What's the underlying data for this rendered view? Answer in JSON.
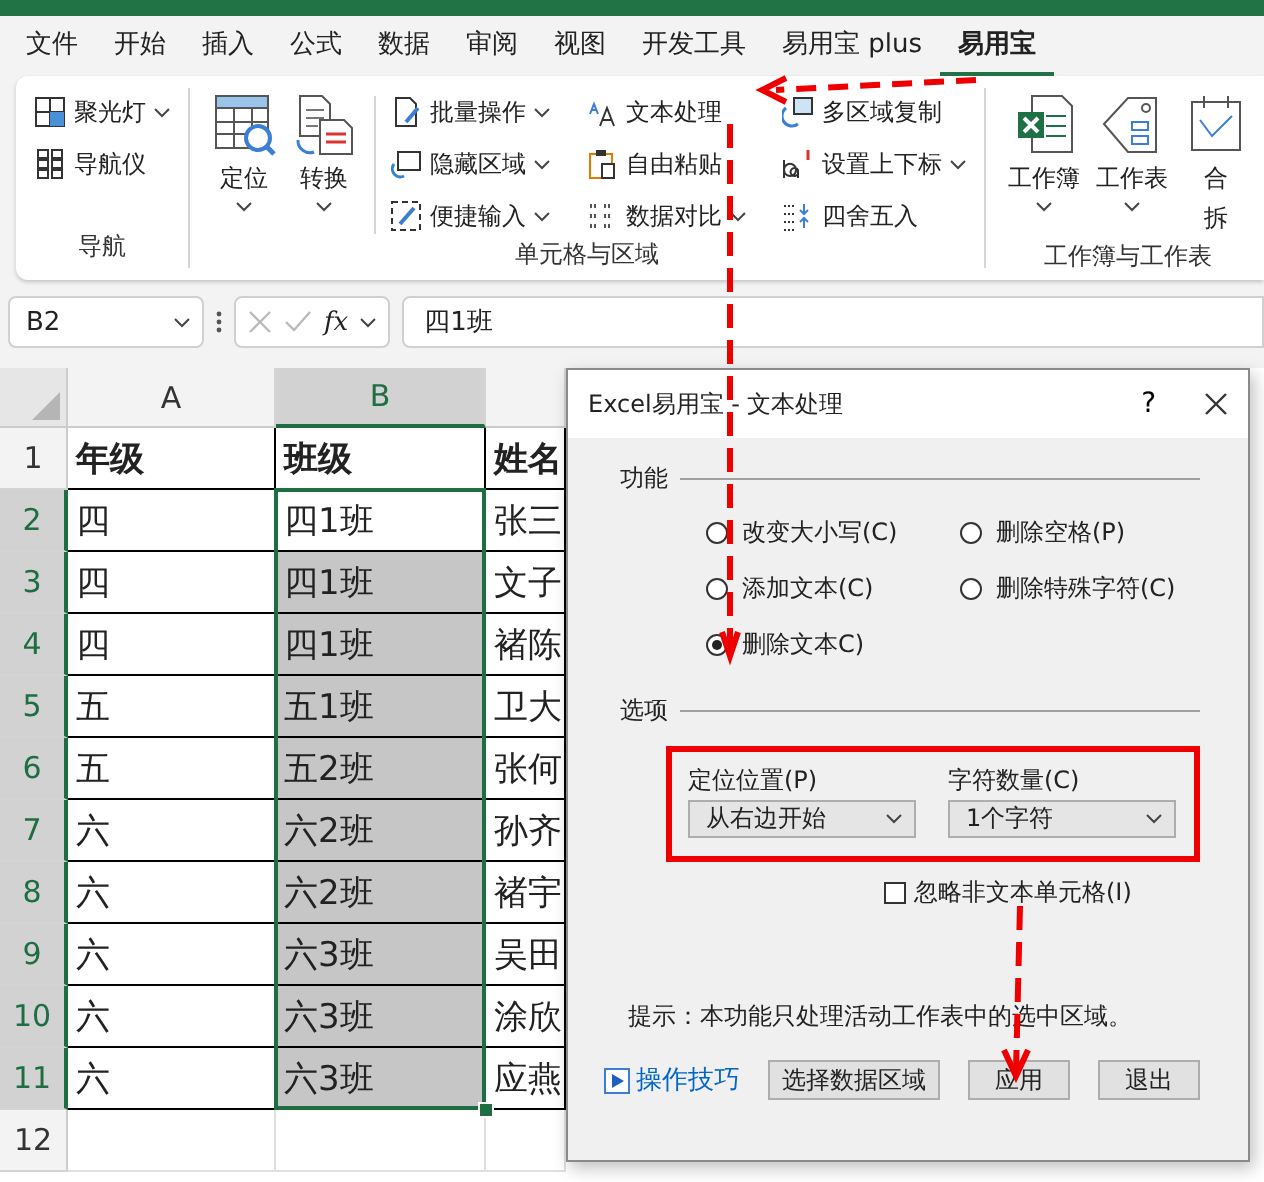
{
  "menu_tabs": [
    {
      "label": "文件",
      "selected": false
    },
    {
      "label": "开始",
      "selected": false
    },
    {
      "label": "插入",
      "selected": false
    },
    {
      "label": "公式",
      "selected": false
    },
    {
      "label": "数据",
      "selected": false
    },
    {
      "label": "审阅",
      "selected": false
    },
    {
      "label": "视图",
      "selected": false
    },
    {
      "label": "开发工具",
      "selected": false
    },
    {
      "label": "易用宝 plus",
      "selected": false
    },
    {
      "label": "易用宝",
      "selected": true
    }
  ],
  "ribbon": {
    "groups": [
      {
        "label": "导航",
        "small_columns": [
          [
            {
              "label": "聚光灯",
              "dropdown": true
            },
            {
              "label": "导航仪",
              "dropdown": false
            }
          ]
        ]
      },
      {
        "label": "单元格与区域",
        "large": [
          {
            "label": "定位",
            "dropdown": true
          },
          {
            "label": "转换",
            "dropdown": true
          }
        ],
        "small_columns": [
          [
            {
              "label": "批量操作",
              "dropdown": true
            },
            {
              "label": "隐藏区域",
              "dropdown": true
            },
            {
              "label": "便捷输入",
              "dropdown": true
            }
          ],
          [
            {
              "label": "文本处理",
              "dropdown": false
            },
            {
              "label": "自由粘贴",
              "dropdown": false
            },
            {
              "label": "数据对比",
              "dropdown": true
            }
          ],
          [
            {
              "label": "多区域复制",
              "dropdown": false
            },
            {
              "label": "设置上下标",
              "dropdown": true
            },
            {
              "label": "四舍五入",
              "dropdown": false
            }
          ]
        ]
      },
      {
        "label": "工作簿与工作表",
        "large": [
          {
            "label": "工作簿",
            "dropdown": true
          },
          {
            "label": "工作表",
            "dropdown": true
          },
          {
            "label": "合",
            "second_line": "拆",
            "dropdown": false
          }
        ]
      }
    ]
  },
  "formula_bar": {
    "name_box": "B2",
    "function_label": "fx",
    "formula": "四1班"
  },
  "sheet": {
    "columns": [
      {
        "label": "A",
        "selected": false
      },
      {
        "label": "B",
        "selected": true
      }
    ],
    "rows": [
      {
        "number": "1",
        "kind": "header",
        "selected": false,
        "cells": [
          {
            "text": "年级",
            "selected": false
          },
          {
            "text": "班级",
            "selected": false
          },
          {
            "text": "姓名",
            "selected": false
          }
        ]
      },
      {
        "number": "2",
        "kind": "data",
        "selected": true,
        "cells": [
          {
            "text": "四",
            "selected": false
          },
          {
            "text": "四1班",
            "selected": false
          },
          {
            "text": "张三",
            "selected": false
          }
        ]
      },
      {
        "number": "3",
        "kind": "data",
        "selected": true,
        "cells": [
          {
            "text": "四",
            "selected": false
          },
          {
            "text": "四1班",
            "selected": true
          },
          {
            "text": "文子",
            "selected": false
          }
        ]
      },
      {
        "number": "4",
        "kind": "data",
        "selected": true,
        "cells": [
          {
            "text": "四",
            "selected": false
          },
          {
            "text": "四1班",
            "selected": true
          },
          {
            "text": "褚陈",
            "selected": false
          }
        ]
      },
      {
        "number": "5",
        "kind": "data",
        "selected": true,
        "cells": [
          {
            "text": "五",
            "selected": false
          },
          {
            "text": "五1班",
            "selected": true
          },
          {
            "text": "卫大",
            "selected": false
          }
        ]
      },
      {
        "number": "6",
        "kind": "data",
        "selected": true,
        "cells": [
          {
            "text": "五",
            "selected": false
          },
          {
            "text": "五2班",
            "selected": true
          },
          {
            "text": "张何",
            "selected": false
          }
        ]
      },
      {
        "number": "7",
        "kind": "data",
        "selected": true,
        "cells": [
          {
            "text": "六",
            "selected": false
          },
          {
            "text": "六2班",
            "selected": true
          },
          {
            "text": "孙齐",
            "selected": false
          }
        ]
      },
      {
        "number": "8",
        "kind": "data",
        "selected": true,
        "cells": [
          {
            "text": "六",
            "selected": false
          },
          {
            "text": "六2班",
            "selected": true
          },
          {
            "text": "褚宇",
            "selected": false
          }
        ]
      },
      {
        "number": "9",
        "kind": "data",
        "selected": true,
        "cells": [
          {
            "text": "六",
            "selected": false
          },
          {
            "text": "六3班",
            "selected": true
          },
          {
            "text": "吴田",
            "selected": false
          }
        ]
      },
      {
        "number": "10",
        "kind": "data",
        "selected": true,
        "cells": [
          {
            "text": "六",
            "selected": false
          },
          {
            "text": "六3班",
            "selected": true
          },
          {
            "text": "涂欣",
            "selected": false
          }
        ]
      },
      {
        "number": "11",
        "kind": "data",
        "selected": true,
        "cells": [
          {
            "text": "六",
            "selected": false
          },
          {
            "text": "六3班",
            "selected": true
          },
          {
            "text": "应燕",
            "selected": false
          }
        ]
      },
      {
        "number": "12",
        "kind": "empty",
        "selected": false
      }
    ]
  },
  "dialog": {
    "title": "Excel易用宝 - 文本处理",
    "help_label": "?",
    "function_label": "功能",
    "functions": [
      {
        "label": "改变大小写(C)",
        "selected": false
      },
      {
        "label": "删除空格(P)",
        "selected": false
      },
      {
        "label": "添加文本(C)",
        "selected": false
      },
      {
        "label": "删除特殊字符(C)",
        "selected": false
      },
      {
        "label": "删除文本C)",
        "selected": true
      }
    ],
    "options_label": "选项",
    "dropdowns": [
      {
        "label": "定位位置(P)",
        "value": "从右边开始"
      },
      {
        "label": "字符数量(C)",
        "value": "1个字符"
      }
    ],
    "checkbox": {
      "label": "忽略非文本单元格(I)",
      "checked": false
    },
    "hint": "提示：本功能只处理活动工作表中的选中区域。",
    "link": "操作技巧",
    "buttons": [
      "选择数据区域",
      "应用",
      "退出"
    ]
  }
}
